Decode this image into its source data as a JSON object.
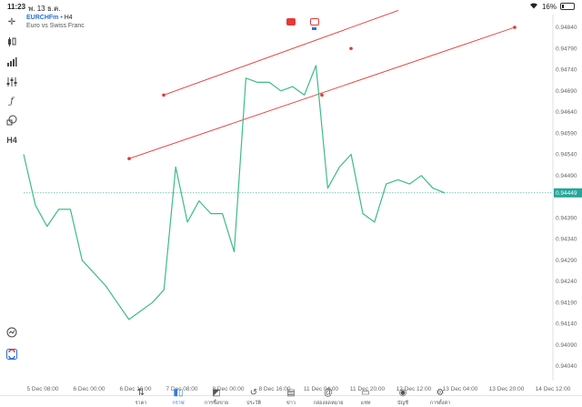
{
  "status_bar": {
    "time": "11:23",
    "date": "พ. 13 ธ.ค.",
    "battery": "16%",
    "battery_level": 0.16
  },
  "symbol": {
    "name": "EURCHFm",
    "separator": "•",
    "timeframe": "H4",
    "description": "Euro vs Swiss Franc"
  },
  "left_toolbar": {
    "timeframe_label": "H4",
    "icons": [
      "crosshair-icon",
      "candlestick-icon",
      "bar-chart-icon",
      "sliders-icon",
      "function-icon",
      "shapes-icon",
      "zoom-icon",
      "logo-icon"
    ]
  },
  "current_price": "0.94449",
  "colors": {
    "line": "#3dbb8a",
    "trendline": "#e53935",
    "price_tag": "#26a69a",
    "accent": "#2a7de1"
  },
  "chart_data": {
    "type": "line",
    "y_ticks": [
      "0.94840",
      "0.94790",
      "0.94740",
      "0.94690",
      "0.94640",
      "0.94590",
      "0.94540",
      "0.94490",
      "0.94449",
      "0.94390",
      "0.94340",
      "0.94290",
      "0.94240",
      "0.94190",
      "0.94140",
      "0.94090",
      "0.94040"
    ],
    "x_ticks": [
      "5 Dec 08:00",
      "6 Dec 00:00",
      "6 Dec 16:00",
      "7 Dec 08:00",
      "8 Dec 00:00",
      "8 Dec 16:00",
      "11 Dec 04:00",
      "11 Dec 20:00",
      "12 Dec 12:00",
      "13 Dec 04:00",
      "13 Dec 20:00",
      "14 Dec 12:00"
    ],
    "ylim": [
      0.94,
      0.9488
    ],
    "series": [
      {
        "values": [
          0.9454,
          0.9442,
          0.9437,
          0.9441,
          0.9441,
          0.9429,
          0.9426,
          0.9423,
          0.9419,
          0.9415,
          0.9417,
          0.9419,
          0.9422,
          0.9451,
          0.9438,
          0.9443,
          0.944,
          0.944,
          0.9431,
          0.9472,
          0.9471,
          0.9471,
          0.9469,
          0.947,
          0.9468,
          0.9475,
          0.9446,
          0.9451,
          0.9454,
          0.944,
          0.9438,
          0.9447,
          0.9448,
          0.9447,
          0.9449,
          0.9446,
          0.94449
        ]
      }
    ],
    "trendlines": [
      {
        "from": 0.9468,
        "to": 0.9488,
        "points": [
          0.9468,
          0.9479
        ]
      },
      {
        "from": 0.9453,
        "to": 0.9484,
        "points": [
          0.9453,
          0.9468,
          0.9484
        ]
      }
    ]
  },
  "bottom_nav": [
    {
      "label": "ราคา",
      "icon": "arrows-updown-icon"
    },
    {
      "label": "กราฟ",
      "icon": "candles-icon",
      "active": true
    },
    {
      "label": "การซื้อขาย",
      "icon": "trade-chart-icon"
    },
    {
      "label": "ประวัติ",
      "icon": "history-icon"
    },
    {
      "label": "ข่าว",
      "icon": "news-icon"
    },
    {
      "label": "กล่องจดหมาย",
      "icon": "at-icon"
    },
    {
      "label": "แชท",
      "icon": "chat-icon"
    },
    {
      "label": "บัญชี",
      "icon": "account-icon"
    },
    {
      "label": "การตั้งค่า",
      "icon": "settings-icon"
    }
  ]
}
